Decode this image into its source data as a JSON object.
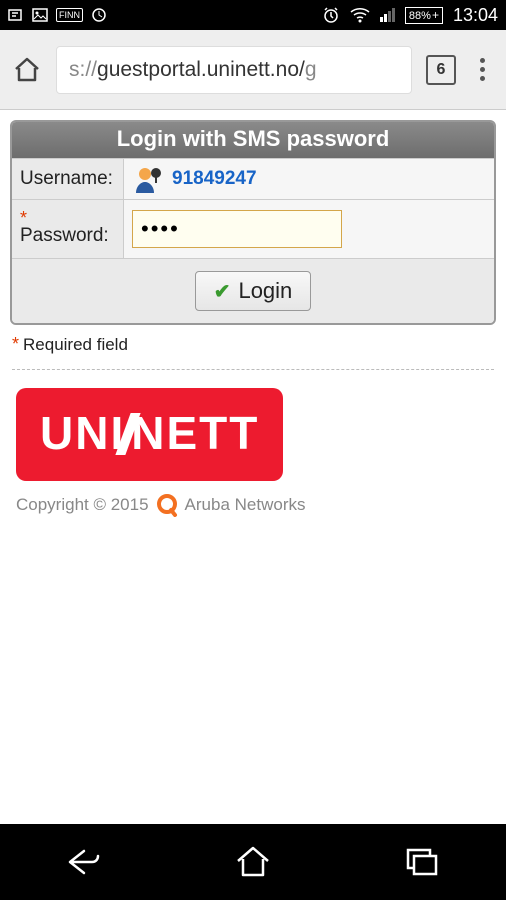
{
  "status": {
    "battery": "88%",
    "time": "13:04"
  },
  "browser": {
    "url_prefix": "s://",
    "url_main": "guestportal.uninett.no/",
    "url_suffix": "g",
    "tab_count": "6"
  },
  "panel": {
    "title": "Login with SMS password",
    "username_label": "Username:",
    "username_value": "91849247",
    "password_label": "Password:",
    "password_value": "••••",
    "login_label": "Login"
  },
  "required_note": "Required field",
  "logo_text": "UNINETT",
  "footer": {
    "copyright": "Copyright © 2015",
    "vendor": "Aruba Networks"
  }
}
